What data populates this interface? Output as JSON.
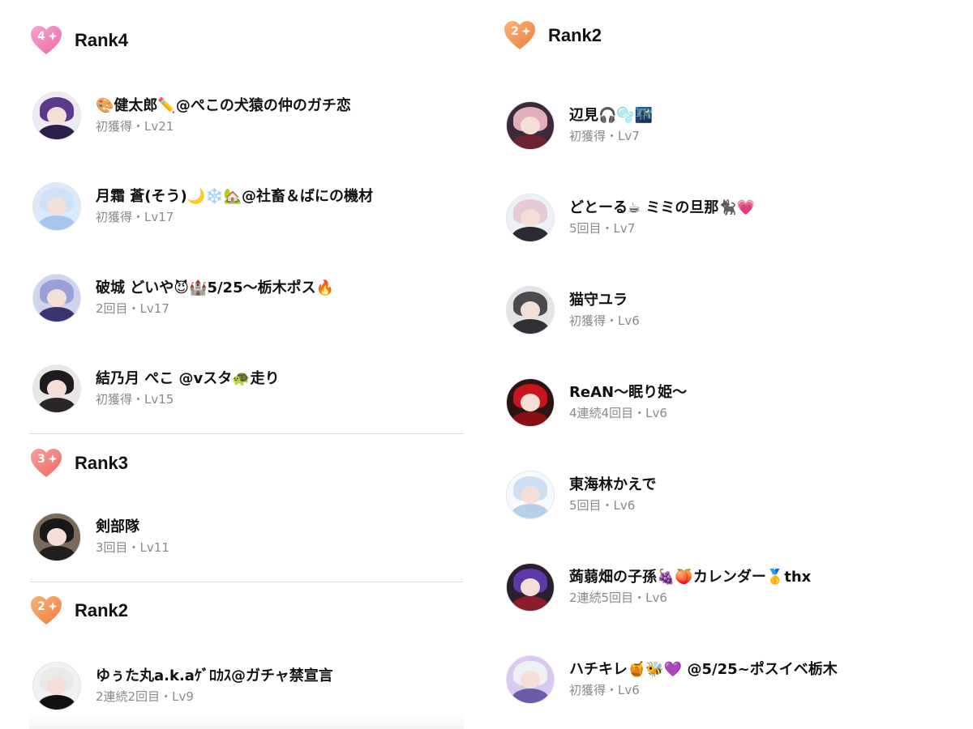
{
  "left": {
    "sections": [
      {
        "rank": "Rank4",
        "badge_number": "4",
        "badge_color": "#f07fb5",
        "users": [
          {
            "name": "🎨健太郎✏️@ぺこの犬猿の仲のガチ恋",
            "meta": "初獲得・Lv21"
          },
          {
            "name": "月霜 蒼(そう)🌙❄️🏡@社畜＆ばにの機材",
            "meta": "初獲得・Lv17"
          },
          {
            "name": "破城 どいや😈🏰5/25〜栃木ポス🔥",
            "meta": "2回目・Lv17"
          },
          {
            "name": "結乃月 ぺこ @vスタ🐢走り",
            "meta": "初獲得・Lv15"
          }
        ]
      },
      {
        "rank": "Rank3",
        "badge_number": "3",
        "badge_color": "#f27a7a",
        "users": [
          {
            "name": "剣部隊",
            "meta": "3回目・Lv11"
          }
        ]
      },
      {
        "rank": "Rank2",
        "badge_number": "2",
        "badge_color": "#f39254",
        "users": [
          {
            "name": "ゆぅた丸a.k.aｹﾞﾛｶｽ@ガチャ禁宣言",
            "meta": "2連続2回目・Lv9"
          }
        ]
      }
    ]
  },
  "right": {
    "sections": [
      {
        "rank": "Rank2",
        "badge_number": "2",
        "badge_color": "#f39254",
        "users": [
          {
            "name": "辺見🎧🫧🌃",
            "meta": "初獲得・Lv7"
          },
          {
            "name": "どとーる☕ ミミの旦那🐈‍⬛💗",
            "meta": "5回目・Lv7"
          },
          {
            "name": "猫守ユラ",
            "meta": "初獲得・Lv6"
          },
          {
            "name": "ReAN〜眠り姫〜",
            "meta": "4連続4回目・Lv6"
          },
          {
            "name": "東海林かえで",
            "meta": "5回目・Lv6"
          },
          {
            "name": " 蒟蒻畑の子孫🍇🍑カレンダー🥇thx",
            "meta": "2連続5回目・Lv6"
          },
          {
            "name": "ハチキレ🍯🐝💜 @5/25~ポスイベ栃木",
            "meta": "初獲得・Lv6"
          }
        ]
      }
    ]
  },
  "icons": {
    "rank_badge": "heart-sparkle-icon",
    "avatar": "user-avatar"
  }
}
